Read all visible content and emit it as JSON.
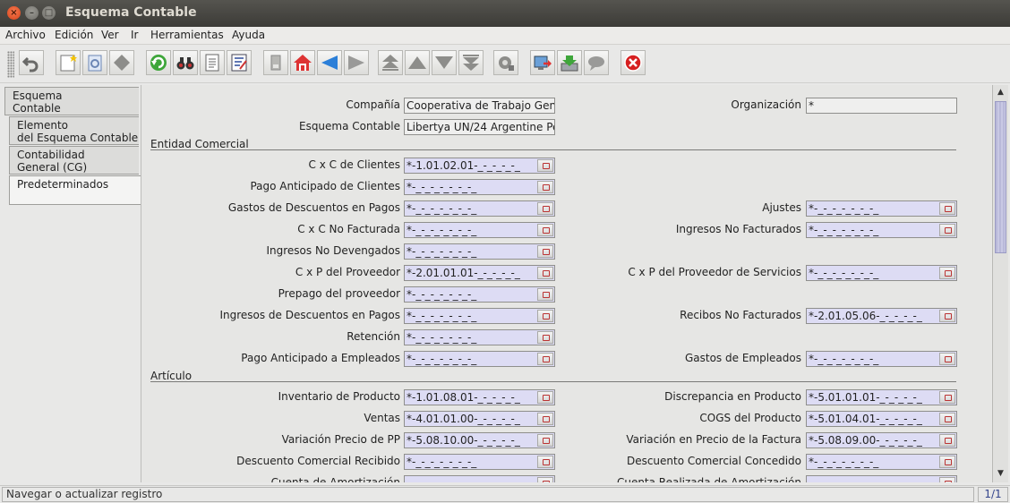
{
  "window": {
    "title": "Esquema Contable"
  },
  "menu": [
    "Archivo",
    "Edición",
    "Ver",
    "Ir",
    "Herramientas",
    "Ayuda"
  ],
  "toolbar": {
    "icons": [
      "undo-icon",
      "new-record-icon",
      "copy-icon",
      "delete-icon",
      "refresh-icon",
      "find-icon",
      "report-icon",
      "detail-icon",
      "attachment-icon",
      "home-icon",
      "previous-icon",
      "next-icon",
      "first-icon",
      "up-icon",
      "down-icon",
      "last-icon",
      "settings-icon",
      "export-icon",
      "import-icon",
      "chat-icon",
      "close-window-icon"
    ]
  },
  "tabs": [
    {
      "label": "Esquema\nContable"
    },
    {
      "label": "Elemento\ndel Esquema Contable"
    },
    {
      "label": "Contabilidad\nGeneral (CG)"
    },
    {
      "label": "Predeterminados"
    }
  ],
  "form": {
    "compania_label": "Compañía",
    "compania_value": "Cooperativa de Trabajo Gen",
    "organizacion_label": "Organización",
    "organizacion_value": "*",
    "esquema_label": "Esquema Contable",
    "esquema_value": "Libertya UN/24 Argentine Pe",
    "section_entidad": "Entidad Comercial",
    "section_articulo": "Artículo",
    "left_fields": [
      {
        "label": "C x C de Clientes",
        "value": "*-1.01.02.01-_-_-_-_-_"
      },
      {
        "label": "Pago Anticipado de Clientes",
        "value": "*-_-_-_-_-_-_-_"
      },
      {
        "label": "Gastos de Descuentos en Pagos",
        "value": "*-_-_-_-_-_-_-_"
      },
      {
        "label": "C x C No Facturada",
        "value": "*-_-_-_-_-_-_-_"
      },
      {
        "label": "Ingresos No Devengados",
        "value": "*-_-_-_-_-_-_-_"
      },
      {
        "label": "C x P del Proveedor",
        "value": "*-2.01.01.01-_-_-_-_-_"
      },
      {
        "label": "Prepago del proveedor",
        "value": "*-_-_-_-_-_-_-_"
      },
      {
        "label": "Ingresos de Descuentos en Pagos",
        "value": "*-_-_-_-_-_-_-_"
      },
      {
        "label": "Retención",
        "value": "*-_-_-_-_-_-_-_"
      },
      {
        "label": "Pago Anticipado a Empleados",
        "value": "*-_-_-_-_-_-_-_"
      }
    ],
    "right_fields": [
      {
        "label": "Ajustes",
        "value": "*-_-_-_-_-_-_-_"
      },
      {
        "label": "Ingresos No Facturados",
        "value": "*-_-_-_-_-_-_-_"
      },
      {
        "label": "C x P del Proveedor de Servicios",
        "value": "*-_-_-_-_-_-_-_"
      },
      {
        "label": "Recibos No Facturados",
        "value": "*-2.01.05.06-_-_-_-_-_"
      },
      {
        "label": "Gastos de Empleados",
        "value": "*-_-_-_-_-_-_-_"
      }
    ],
    "art_left": [
      {
        "label": "Inventario de Producto",
        "value": "*-1.01.08.01-_-_-_-_-_"
      },
      {
        "label": "Ventas",
        "value": "*-4.01.01.00-_-_-_-_-_"
      },
      {
        "label": "Variación Precio de PP",
        "value": "*-5.08.10.00-_-_-_-_-_"
      },
      {
        "label": "Descuento Comercial Recibido",
        "value": "*-_-_-_-_-_-_-_"
      },
      {
        "label": "Cuenta de Amortización",
        "value": ""
      }
    ],
    "art_right": [
      {
        "label": "Discrepancia en Producto",
        "value": "*-5.01.01.01-_-_-_-_-_"
      },
      {
        "label": "COGS del Producto",
        "value": "*-5.01.04.01-_-_-_-_-_"
      },
      {
        "label": "Variación en Precio de la Factura",
        "value": "*-5.08.09.00-_-_-_-_-_"
      },
      {
        "label": "Descuento Comercial Concedido",
        "value": "*-_-_-_-_-_-_-_"
      },
      {
        "label": "Cuenta Realizada de Amortización",
        "value": ""
      }
    ]
  },
  "status": {
    "message": "Navegar o actualizar registro",
    "count": "1/1"
  }
}
